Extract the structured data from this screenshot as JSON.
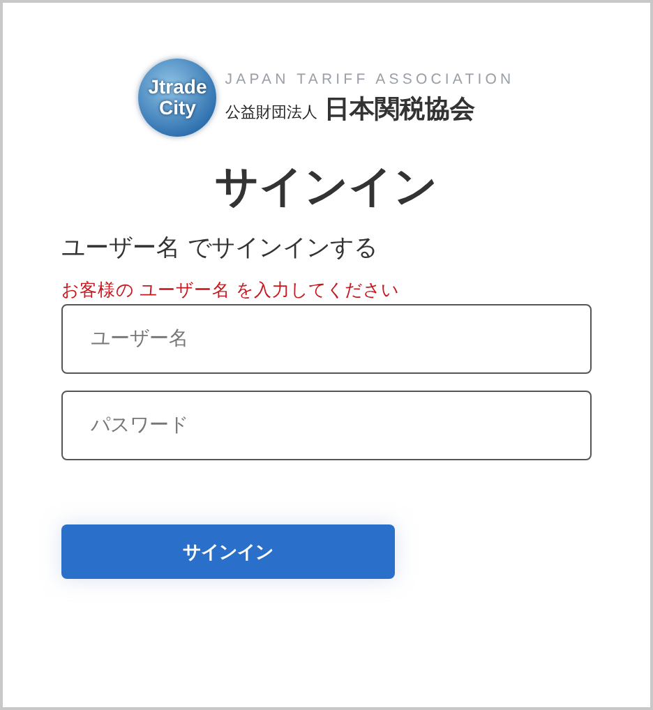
{
  "logo": {
    "badge_lines": [
      "Jtrade",
      "City"
    ],
    "tagline": "JAPAN TARIFF ASSOCIATION",
    "org_type": "公益財団法人",
    "org_name": "日本関税協会"
  },
  "title": "サインイン",
  "subtitle": "ユーザー名 でサインインする",
  "error": "お客様の ユーザー名 を入力してください",
  "fields": [
    {
      "placeholder": "ユーザー名"
    },
    {
      "placeholder": "パスワード"
    }
  ],
  "button": "サインイン"
}
